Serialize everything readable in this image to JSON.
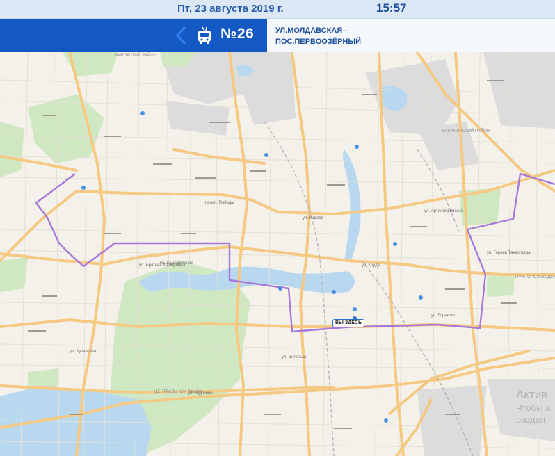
{
  "header": {
    "date": "Пт, 23 августа 2019 г.",
    "time": "15:57"
  },
  "route": {
    "number": "№26",
    "name_line1": "УЛ.МОЛДАВСКАЯ -",
    "name_line2": "ПОС.ПЕРВООЗЁРНЫЙ",
    "type_icon": "trolleybus-icon",
    "back_icon": "chevron-left-icon"
  },
  "map": {
    "you_are_here": "ВЫ ЗДЕСЬ",
    "district_labels": [
      "КИРОВСКИЙ РАЙОН",
      "ЦЕНТРАЛЬНЫЙ РАЙОН",
      "КАЛИНИНСКИЙ РАЙОН",
      "ТРАКТОРОЗАВОДСКИЙ РАЙОН"
    ],
    "street_labels": [
      "просп. Победы",
      "ул. Братьев Кашириных",
      "ул. Кирова",
      "ул. Труда",
      "ул. Энгельса",
      "ул. Худякова",
      "ул. Курчатова",
      "ул. Артиллерийская",
      "ул. Героев Танкограда",
      "ул. Горького",
      "ул. Комаровского"
    ],
    "colors": {
      "route_line": "#a778d8",
      "major_road": "#f5c982",
      "water": "#b8d8f0",
      "park": "#cfe8c2",
      "background": "#f4f1ea"
    }
  },
  "watermark": {
    "line1": "Актив",
    "line2": "Чтобы а",
    "line3": "раздел"
  },
  "colors": {
    "header_blue": "#1458c4",
    "top_bar": "#dde8f6"
  }
}
